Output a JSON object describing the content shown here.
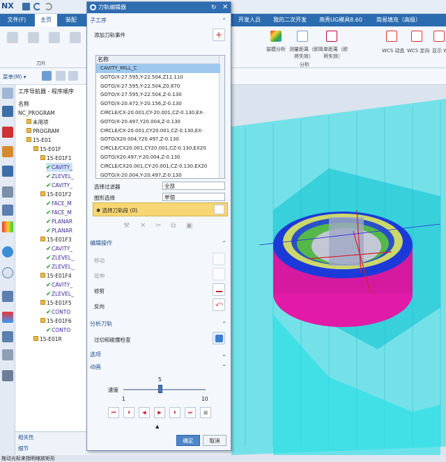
{
  "app": {
    "logo": "NX"
  },
  "tabs": [
    {
      "label": "文件(F)",
      "active": false
    },
    {
      "label": "主页",
      "active": true
    },
    {
      "label": "装配",
      "active": false
    },
    {
      "label": "开发人员",
      "active": false
    },
    {
      "label": "我的二次开发",
      "active": false
    },
    {
      "label": "燕秀UG模具8.60",
      "active": false
    },
    {
      "label": "简易填充（高级）",
      "active": false
    }
  ],
  "ribbon": {
    "group_label": "刀片",
    "analysis_group_label": "分析",
    "tools": [
      {
        "label": "拔模分析"
      },
      {
        "label": "测量距离（即将失效）"
      },
      {
        "label": "简单距离（即将失效）"
      },
      {
        "label": "WCS 动态"
      },
      {
        "label": "WCS 定向"
      },
      {
        "label": "显示 W"
      }
    ]
  },
  "toolbar2": {
    "menu_label": "菜单(M) ▾"
  },
  "navigator": {
    "title": "工序导航器 - 程序顺序",
    "column_name": "名称",
    "nodes": [
      {
        "label": "NC_PROGRAM",
        "level": 0,
        "kind": "root"
      },
      {
        "label": "未用项",
        "level": 1,
        "kind": "folder"
      },
      {
        "label": "PROGRAM",
        "level": 1,
        "kind": "folder"
      },
      {
        "label": "15-E01",
        "level": 1,
        "kind": "folder"
      },
      {
        "label": "15-E01F",
        "level": 2,
        "kind": "folder"
      },
      {
        "label": "15-E01F1",
        "level": 3,
        "kind": "folder"
      },
      {
        "label": "CAVITY_",
        "level": 4,
        "kind": "op",
        "selected": true
      },
      {
        "label": "ZLEVEL_",
        "level": 4,
        "kind": "op"
      },
      {
        "label": "CAVITY_",
        "level": 4,
        "kind": "op"
      },
      {
        "label": "15-E01F2",
        "level": 3,
        "kind": "folder"
      },
      {
        "label": "FACE_M",
        "level": 4,
        "kind": "op"
      },
      {
        "label": "FACE_M",
        "level": 4,
        "kind": "op"
      },
      {
        "label": "PLANAR",
        "level": 4,
        "kind": "op"
      },
      {
        "label": "PLANAR",
        "level": 4,
        "kind": "op"
      },
      {
        "label": "15-E01F3",
        "level": 3,
        "kind": "folder"
      },
      {
        "label": "CAVITY_",
        "level": 4,
        "kind": "op"
      },
      {
        "label": "ZLEVEL_",
        "level": 4,
        "kind": "op"
      },
      {
        "label": "ZLEVEL_",
        "level": 4,
        "kind": "op"
      },
      {
        "label": "15-E01F4",
        "level": 3,
        "kind": "folder"
      },
      {
        "label": "CAVITY_",
        "level": 4,
        "kind": "op"
      },
      {
        "label": "ZLEVEL_",
        "level": 4,
        "kind": "op"
      },
      {
        "label": "15-E01F5",
        "level": 3,
        "kind": "folder"
      },
      {
        "label": "CONTO",
        "level": 4,
        "kind": "op"
      },
      {
        "label": "15-E01F6",
        "level": 3,
        "kind": "folder"
      },
      {
        "label": "CONTO",
        "level": 4,
        "kind": "op"
      },
      {
        "label": "15-E01R",
        "level": 2,
        "kind": "folder"
      }
    ],
    "bottom": {
      "related": "相关性",
      "details": "细节"
    }
  },
  "dialog": {
    "title": "刀轨编辑器",
    "sub_op_section": "子工序",
    "add_event_label": "添加刀轨事件",
    "list_header": "名称",
    "list_rows": [
      "CAVITY_MILL_C",
      "GOTO/X-27.595,Y-22.504,Z11.110",
      "GOTO/X-27.595,Y-22.504,Z0.870",
      "GOTO/X-27.595,Y-22.504,Z-0.130",
      "GOTO/X-20.472,Y-20.156,Z-0.130",
      "CIRCLE/CX-20.001,CY-20.001,CZ-0.130,EX-",
      "GOTO/X-20.497,Y20.004,Z-0.130",
      "CIRCLE/CX-20.001,CY20.001,CZ-0.130,EX-",
      "GOTO/X20.004,Y20.497,Z-0.130",
      "CIRCLE/CX20.001,CY20.001,CZ-0.130,EX20",
      "GOTO/X20.497,Y-20.004,Z-0.130",
      "CIRCLE/CX20.001,CY-20.001,CZ-0.130,EX20",
      "GOTO/X-20.004,Y-20.497,Z-0.130"
    ],
    "filter_label": "选择过滤器",
    "filter_value": "全部",
    "shape_select_label": "图形选择",
    "shape_select_value": "单個",
    "select_path_label": "✱ 选择刀轨段 (0)",
    "edit_section": "编辑操作",
    "edit_ops": [
      {
        "label": "移动",
        "enabled": false
      },
      {
        "label": "延伸",
        "enabled": false
      },
      {
        "label": "修剪",
        "enabled": true
      },
      {
        "label": "反向",
        "enabled": true
      }
    ],
    "analysis_section": "分析刀轨",
    "gouge_check_label": "过切和碰撞检查",
    "options_section": "选项",
    "animation_section": "动画",
    "speed_label": "速度",
    "speed_value": "5",
    "speed_min": "1",
    "speed_max": "10",
    "ok_label": "确定",
    "cancel_label": "取消"
  },
  "statusbar": {
    "text": "拖动光标来指明缩放矩形"
  }
}
